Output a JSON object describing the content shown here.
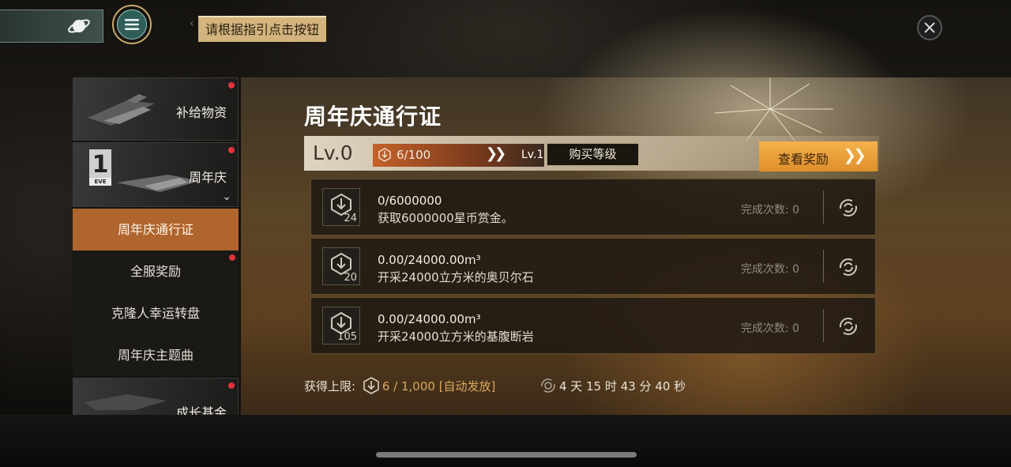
{
  "top_bar": {
    "guide_tip": "请根据指引点击按钮",
    "planet_icon": "planet-icon",
    "menu_icon": "menu-icon",
    "close_icon": "close-icon"
  },
  "sidebar": {
    "items": [
      {
        "label": "补给物资",
        "has_dot": true
      },
      {
        "label": "周年庆",
        "has_dot": true,
        "badge": "1",
        "badge_sub": "EVE"
      },
      {
        "label": "周年庆通行证",
        "active": true
      },
      {
        "label": "全服奖励",
        "has_dot": true
      },
      {
        "label": "克隆人幸运转盘"
      },
      {
        "label": "周年庆主题曲"
      },
      {
        "label": "成长基金",
        "has_dot": true
      }
    ]
  },
  "main": {
    "title": "周年庆通行证",
    "level": {
      "current": "Lv.0",
      "xp": "6/100",
      "next": "Lv.1",
      "buy_label": "购买等级"
    },
    "view_rewards_label": "查看奖励",
    "tasks": [
      {
        "icon_num": "24",
        "progress": "0/6000000",
        "desc": "获取6000000星币赏金。",
        "count": "完成次数: 0"
      },
      {
        "icon_num": "20",
        "progress": "0.00/24000.00m³",
        "desc": "开采24000立方米的奥贝尔石",
        "count": "完成次数: 0"
      },
      {
        "icon_num": "105",
        "progress": "0.00/24000.00m³",
        "desc": "开采24000立方米的基腹断岩",
        "count": "完成次数: 0"
      }
    ],
    "footer": {
      "limit_label": "获得上限:",
      "limit_value": "6 / 1,000",
      "auto_label": "[自动发放]",
      "time_left": "4 天 15 时 43 分 40 秒"
    }
  },
  "colors": {
    "accent_orange": "#df8f2b",
    "active_tab": "#b0652e",
    "guide_tip_bg": "#d3b47e",
    "red_dot": "#e0343a"
  }
}
